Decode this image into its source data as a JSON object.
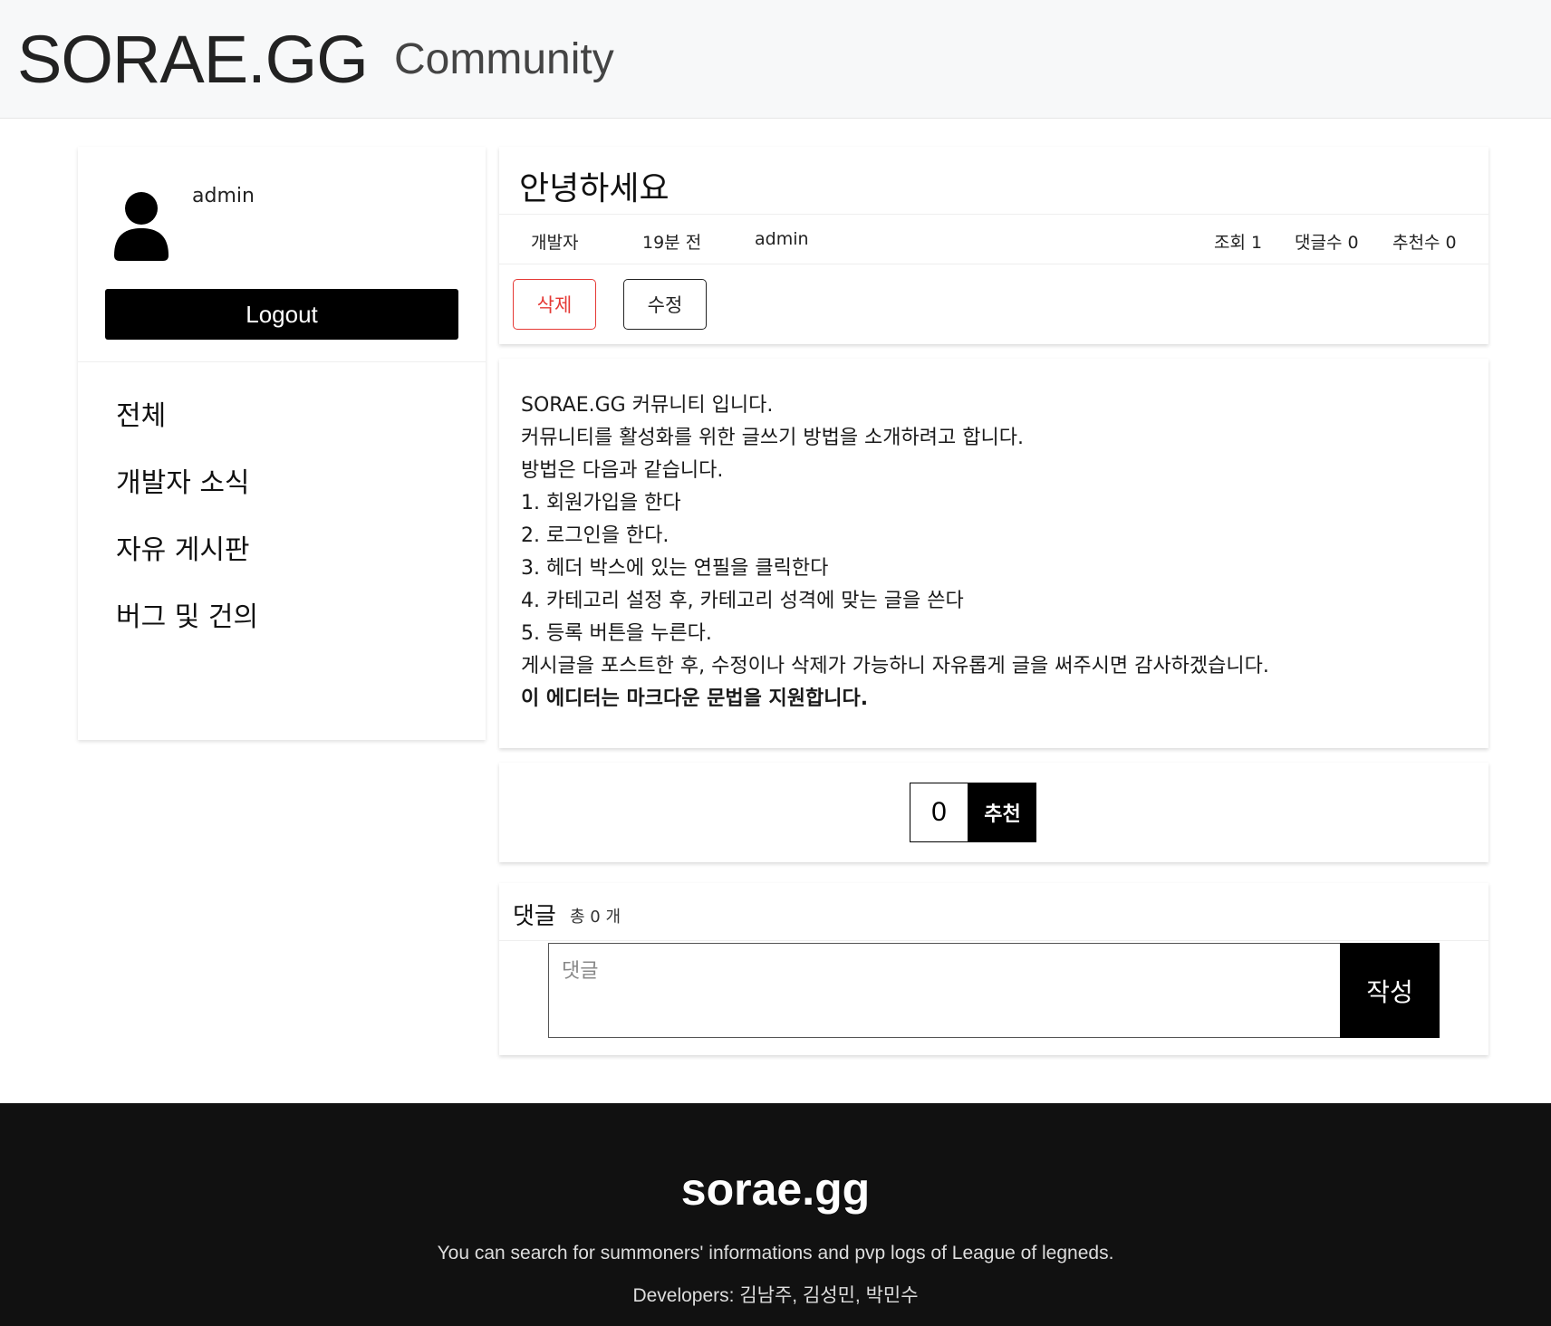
{
  "header": {
    "logo": "SORAE.GG",
    "section": "Community"
  },
  "sidebar": {
    "username": "admin",
    "logout_label": "Logout",
    "nav": [
      {
        "label": "전체"
      },
      {
        "label": "개발자 소식"
      },
      {
        "label": "자유 게시판"
      },
      {
        "label": "버그 및 건의"
      }
    ]
  },
  "post": {
    "title": "안녕하세요",
    "category": "개발자",
    "time": "19분 전",
    "author": "admin",
    "views": "조회 1",
    "comments": "댓글수 0",
    "recommends": "추천수 0",
    "delete_label": "삭제",
    "edit_label": "수정",
    "body_lines": [
      "SORAE.GG 커뮤니티 입니다.",
      "커뮤니티를 활성화를 위한 글쓰기 방법을 소개하려고 합니다.",
      "방법은 다음과 같습니다.",
      "1. 회원가입을 한다",
      "2. 로그인을 한다.",
      "3. 헤더 박스에 있는 연필을 클릭한다",
      "4. 카테고리 설정 후, 카테고리 성격에 맞는 글을 쓴다",
      "5. 등록 버튼을 누른다.",
      "게시글을 포스트한 후, 수정이나 삭제가 가능하니 자유롭게 글을 써주시면 감사하겠습니다."
    ],
    "body_bold": "이 에디터는 마크다운 문법을 지원합니다."
  },
  "recommend": {
    "count": "0",
    "label": "추천"
  },
  "comments": {
    "title": "댓글",
    "count_text": "총 0 개",
    "placeholder": "댓글",
    "submit_label": "작성"
  },
  "footer": {
    "title": "sorae.gg",
    "description": "You can search for summoners' informations and pvp logs of League of legneds.",
    "developers": "Developers: 김남주, 김성민, 박민수"
  }
}
